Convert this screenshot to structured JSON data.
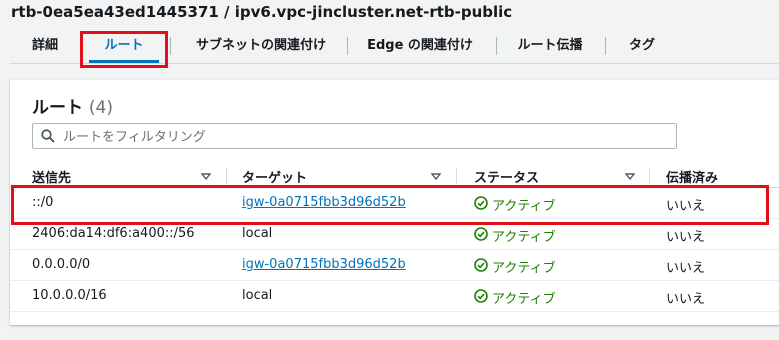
{
  "header": {
    "title": "rtb-0ea5ea43ed1445371 / ipv6.vpc-jincluster.net-rtb-public"
  },
  "tabs": [
    {
      "label": "詳細"
    },
    {
      "label": "ルート"
    },
    {
      "label": "サブネットの関連付け"
    },
    {
      "label": "Edge の関連付け"
    },
    {
      "label": "ルート伝播"
    },
    {
      "label": "タグ"
    }
  ],
  "routes": {
    "title": "ルート",
    "count": "(4)",
    "search_placeholder": "ルートをフィルタリング",
    "columns": [
      "送信先",
      "ターゲット",
      "ステータス",
      "伝播済み"
    ],
    "rows": [
      {
        "destination": "::/0",
        "target": "igw-0a0715fbb3d96d52b",
        "status": "アクティブ",
        "propagated": "いいえ"
      },
      {
        "destination": "2406:da14:df6:a400::/56",
        "target": "local",
        "status": "アクティブ",
        "propagated": "いいえ"
      },
      {
        "destination": "0.0.0.0/0",
        "target": "igw-0a0715fbb3d96d52b",
        "status": "アクティブ",
        "propagated": "いいえ"
      },
      {
        "destination": "10.0.0.0/16",
        "target": "local",
        "status": "アクティブ",
        "propagated": "いいえ"
      }
    ]
  },
  "colors": {
    "link": "#0073bb",
    "success": "#1d8102",
    "highlight": "#e0101a"
  },
  "icons": {
    "search": "search-icon",
    "sort": "caret-down-icon",
    "status": "check-circle-icon"
  }
}
